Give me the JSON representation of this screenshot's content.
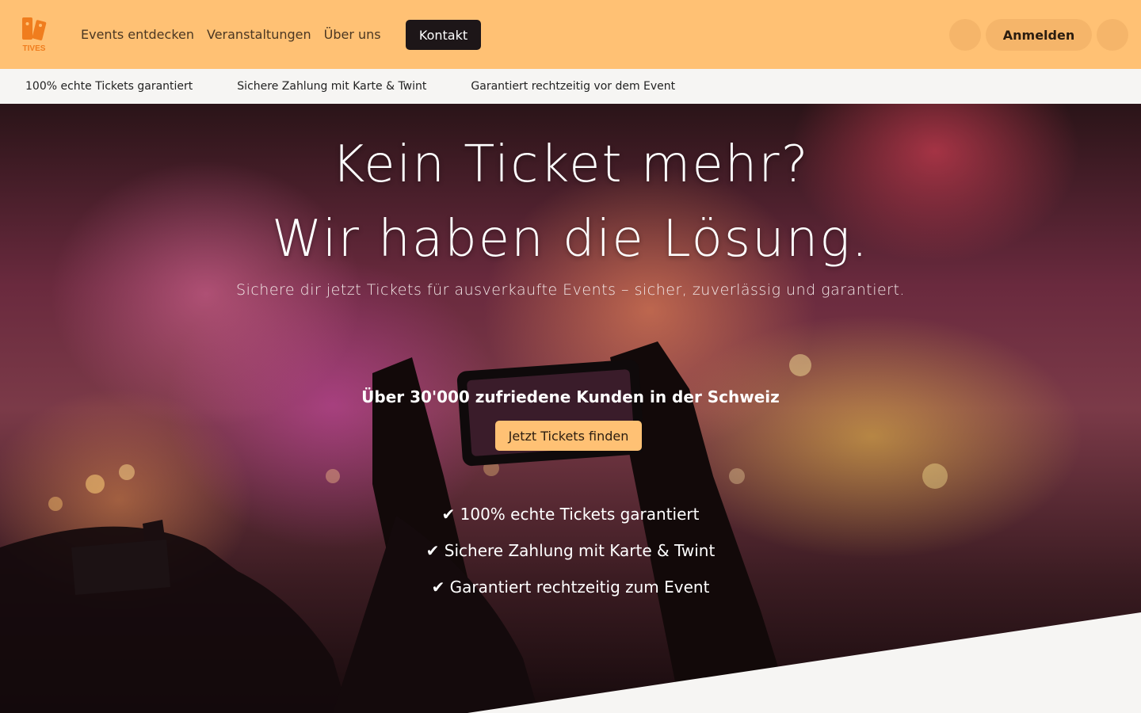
{
  "header": {
    "logo_text": "TIVES",
    "nav": [
      "Events entdecken",
      "Veranstaltungen",
      "Über uns"
    ],
    "contact_label": "Kontakt",
    "login_label": "Anmelden",
    "search_icon": "",
    "menu_icon": ""
  },
  "trustbar": {
    "items": [
      {
        "icon": "",
        "text": "100% echte Tickets garantiert"
      },
      {
        "icon": "",
        "text": "Sichere Zahlung mit Karte & Twint"
      },
      {
        "icon": "",
        "text": "Garantiert rechtzeitig vor dem Event"
      }
    ]
  },
  "hero": {
    "title_line1": "Kein Ticket mehr?",
    "title_line2": "Wir haben die Lösung.",
    "subtitle": "Sichere dir jetzt Tickets für ausverkaufte Events – sicher, zuverlässig und garantiert.",
    "stars": "",
    "rating_text": "Über 30'000 zufriedene Kunden in der Schweiz",
    "cta_label": "Jetzt Tickets finden",
    "checks": [
      "✔ 100% echte Tickets garantiert",
      "✔ Sichere Zahlung mit Karte & Twint",
      "✔ Garantiert rechtzeitig zum Event"
    ]
  },
  "colors": {
    "header_bg": "#ffc174",
    "contact_bg": "#1d1618",
    "cta_bg": "#ffc174",
    "logo_accent": "#f07d1e"
  }
}
